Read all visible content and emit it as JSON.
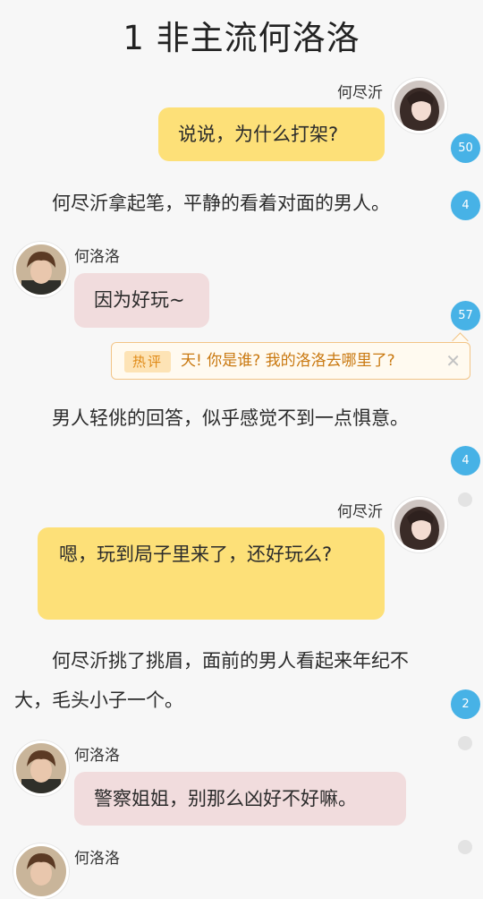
{
  "title": "1 非主流何洛洛",
  "messages": [
    {
      "speaker": "何尽沂",
      "text": "说说，为什么打架?",
      "comments": "50"
    },
    {
      "narration": "何尽沂拿起笔，平静的看着对面的男人。",
      "comments": "4"
    },
    {
      "speaker": "何洛洛",
      "text": "因为好玩~",
      "comments": "57"
    },
    {
      "narration": "男人轻佻的回答，似乎感觉不到一点惧意。",
      "comments": "4"
    },
    {
      "speaker": "何尽沂",
      "text": "嗯，玩到局子里来了，还好玩么?"
    },
    {
      "narration": "何尽沂挑了挑眉，面前的男人看起来年纪不大，毛头小子一个。",
      "comments": "2"
    },
    {
      "speaker": "何洛洛",
      "text": "警察姐姐，别那么凶好不好嘛。"
    },
    {
      "speaker": "何洛洛"
    }
  ],
  "hot_comment": {
    "tag": "热评",
    "text": "天! 你是谁? 我的洛洛去哪里了?",
    "close_icon": "close-icon"
  },
  "colors": {
    "right_bubble": "#fde078",
    "left_bubble": "#f1dcdd",
    "badge": "#47b2e6",
    "hot_tag_text": "#e08a16"
  }
}
